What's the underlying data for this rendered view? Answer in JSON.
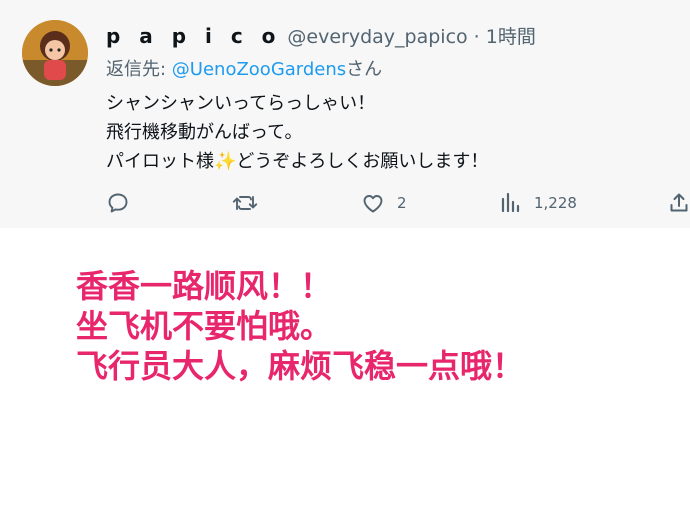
{
  "tweet": {
    "display_name": "p a p i c o",
    "meta": "@everyday_papico · 1時間",
    "reply_prefix": "返信先: ",
    "reply_mention": "@UenoZooGardens",
    "reply_suffix": "さん",
    "lines": {
      "line1": "シャンシャンいってらっしゃい！",
      "line2": "飛行機移動がんばって。",
      "line3_before": "パイロット様",
      "line3_sparkle": "✨",
      "line3_after": "どうぞよろしくお願いします！"
    },
    "actions": {
      "likes_count": "2",
      "views_count": "1,228"
    }
  },
  "caption": {
    "line1": "香香一路顺风！！",
    "line2": "坐飞机不要怕哦。",
    "line3": "飞行员大人，麻烦飞稳一点哦！"
  },
  "icons": {
    "reply": "reply-bubble-icon",
    "retweet": "retweet-icon",
    "like": "heart-icon",
    "views": "bar-chart-icon",
    "share": "share-upload-icon"
  },
  "colors": {
    "caption": "#e8266b",
    "mention": "#1d9bf0",
    "muted": "#536471",
    "text": "#0f1419"
  }
}
